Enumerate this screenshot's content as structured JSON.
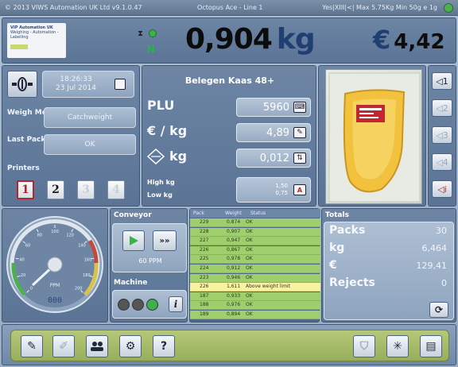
{
  "titlebar": {
    "copyright": "© 2013 VIWS Automation UK Ltd v9.1.0.47",
    "line_name": "Octopus Ace - Line 1",
    "status_text": "Yes|XIII|<| Max 5.75Kg Min 50g e 1g"
  },
  "header": {
    "logo_line1": "VIP Automation UK",
    "logo_line2": "Weighing - Automation - Labelling",
    "stable_indicator": "N",
    "weight_value": "0,904",
    "weight_unit": "kg",
    "price_currency": "€",
    "price_value": "4,42"
  },
  "left": {
    "date": "18:26:33",
    "date2": "23 Jul 2014",
    "weigh_mode_label": "Weigh Mode",
    "weigh_mode_value": "Catchweight",
    "last_pack_label": "Last Pack",
    "last_pack_value": "OK",
    "printers_label": "Printers",
    "printers": [
      "1",
      "2",
      "3",
      "4"
    ]
  },
  "middle": {
    "product_name": "Belegen Kaas 48+",
    "plu_label": "PLU",
    "plu_value": "5960",
    "price_per_kg_label": "€ / kg",
    "price_per_kg_value": "4,89",
    "tare_label": "kg",
    "tare_value": "0,012",
    "high_kg_label": "High kg",
    "low_kg_label": "Low kg",
    "high_kg_value": "1,50",
    "low_kg_value": "0,75"
  },
  "gauge": {
    "unit": "PPM",
    "readout": "000",
    "ticks": [
      "0",
      "20",
      "40",
      "60",
      "80",
      "100",
      "120",
      "140",
      "160",
      "180",
      "200"
    ]
  },
  "conveyor": {
    "title": "Conveyor",
    "ppm": "60 PPM",
    "machine_title": "Machine"
  },
  "log": {
    "col_pack": "Pack",
    "col_weight": "Weight",
    "col_status": "Status",
    "rows": [
      {
        "pack": "229",
        "weight": "0,874",
        "status": "OK"
      },
      {
        "pack": "228",
        "weight": "0,907",
        "status": "OK"
      },
      {
        "pack": "227",
        "weight": "0,947",
        "status": "OK"
      },
      {
        "pack": "226",
        "weight": "0,867",
        "status": "OK"
      },
      {
        "pack": "225",
        "weight": "0,978",
        "status": "OK"
      },
      {
        "pack": "224",
        "weight": "0,912",
        "status": "OK"
      },
      {
        "pack": "223",
        "weight": "0,946",
        "status": "OK"
      },
      {
        "pack": "226",
        "weight": "1,611",
        "status": "Above weight limit",
        "highlight": true
      },
      {
        "pack": "187",
        "weight": "0,933",
        "status": "OK"
      },
      {
        "pack": "188",
        "weight": "0,976",
        "status": "OK"
      },
      {
        "pack": "189",
        "weight": "0,894",
        "status": "OK"
      }
    ]
  },
  "totals": {
    "title": "Totals",
    "packs_label": "Packs",
    "packs_value": "30",
    "kg_label": "kg",
    "kg_value": "6,464",
    "euro_label": "€",
    "euro_value": "129,41",
    "rejects_label": "Rejects",
    "rejects_value": "0"
  },
  "icons": {
    "side_buttons": [
      "label-1-icon",
      "label-2-icon",
      "label-3-icon",
      "label-4-icon",
      "label-active-icon"
    ],
    "toolbar": [
      "edit-icon",
      "pen-icon",
      "users-icon",
      "gear-icon",
      "help-icon",
      "shield-icon",
      "sparkle-icon",
      "dashboard-icon"
    ]
  },
  "colors": {
    "accent": "#1f3f73",
    "ok_row": "#9fce6c",
    "alert_row": "#f8f3a1",
    "reject_red": "#b0282c",
    "run_green": "#3bb34a"
  }
}
